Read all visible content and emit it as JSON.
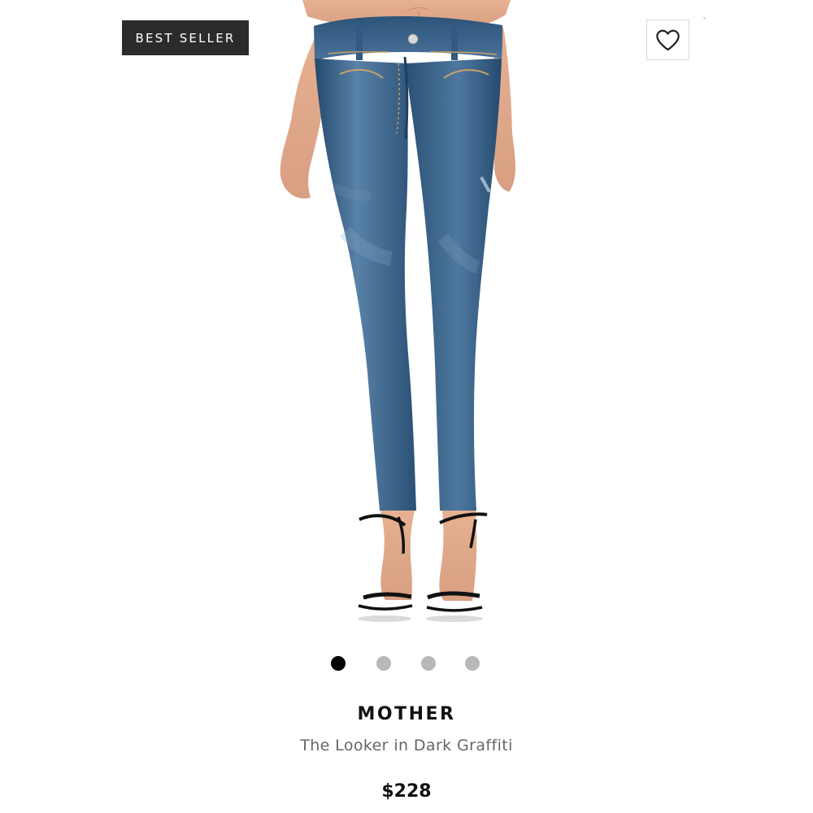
{
  "badge": {
    "label": "BEST SELLER"
  },
  "wishlist": {
    "icon": "heart-outline-icon"
  },
  "carousel": {
    "count": 4,
    "active_index": 0,
    "active_color": "#000000",
    "inactive_color": "#b8b8b8"
  },
  "product": {
    "brand": "MOTHER",
    "name": "The Looker in Dark Graffiti",
    "price": "$228",
    "image": "product-photo"
  },
  "colors": {
    "badge_bg": "#2b2b2b",
    "text_primary": "#111111",
    "text_secondary": "#666666"
  }
}
